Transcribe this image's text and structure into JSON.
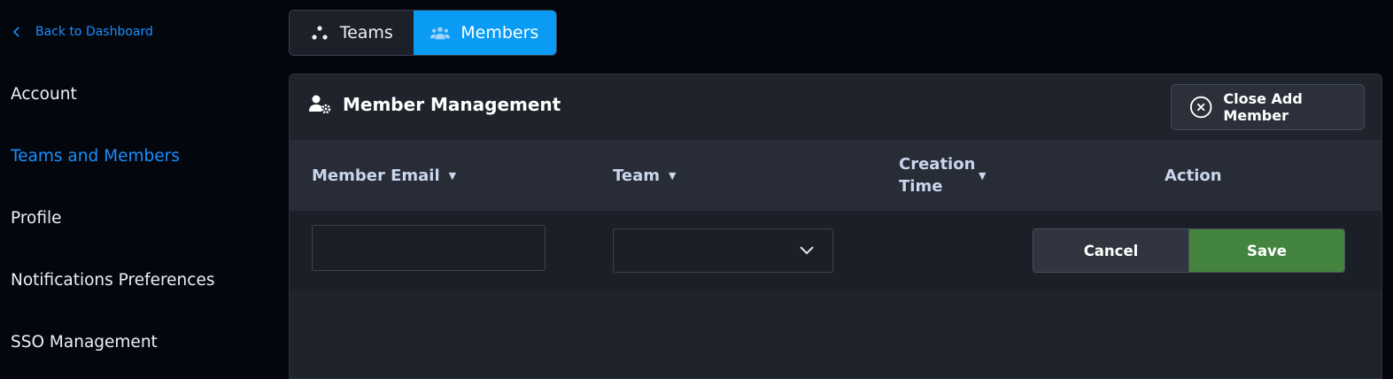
{
  "sidebar": {
    "back_label": "Back to Dashboard",
    "items": [
      {
        "label": "Account"
      },
      {
        "label": "Teams and Members"
      },
      {
        "label": "Profile"
      },
      {
        "label": "Notifications Preferences"
      },
      {
        "label": "SSO Management"
      }
    ],
    "active_item": "Teams and Members"
  },
  "tabs": [
    {
      "label": "Teams",
      "icon": "teams-icon"
    },
    {
      "label": "Members",
      "icon": "members-icon",
      "active": true
    }
  ],
  "panel": {
    "title": "Member Management",
    "title_icon": "user-gear-icon",
    "close_label": "Close Add Member",
    "close_icon": "close-circle-icon"
  },
  "table": {
    "columns": [
      {
        "label": "Member Email",
        "sortable": true
      },
      {
        "label": "Team",
        "sortable": true
      },
      {
        "label": "Creation Time",
        "sortable": true
      },
      {
        "label": "Action",
        "sortable": false
      }
    ],
    "new_row": {
      "email_value": "",
      "team_value": "",
      "cancel_label": "Cancel",
      "save_label": "Save"
    }
  },
  "colors": {
    "accent": "#1a8fff",
    "active_tab": "#0a9cf5",
    "save": "#43843f",
    "background": "#03060d"
  }
}
